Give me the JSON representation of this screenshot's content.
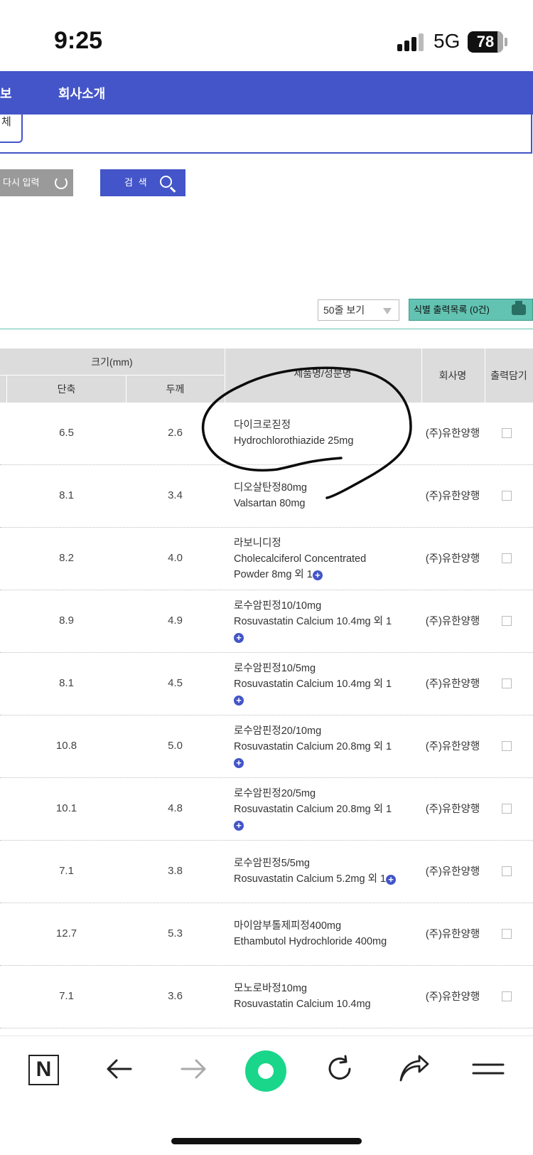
{
  "status": {
    "time": "9:25",
    "network": "5G",
    "battery": "78"
  },
  "nav": {
    "item_partial": "보",
    "company_intro": "회사소개"
  },
  "search": {
    "partial_field_text": "체",
    "reset_label": "다시 입력",
    "search_label": "검 색"
  },
  "list_controls": {
    "per_page": "50줄 보기",
    "print_list": "식별 출력목록 (0건)"
  },
  "table": {
    "headers": {
      "size_group": "크기(mm)",
      "short_axis": "단축",
      "thickness": "두께",
      "product": "제품명/성분명",
      "company": "회사명",
      "add_print": "출력담기"
    },
    "rows": [
      {
        "short": "6.5",
        "thick": "2.6",
        "name": "다이크로짇정",
        "ingredient": "Hydrochlorothiazide   25mg",
        "company": "(주)유한양행"
      },
      {
        "short": "8.1",
        "thick": "3.4",
        "name": "디오살탄정80mg",
        "ingredient": "Valsartan   80mg",
        "company": "(주)유한양행"
      },
      {
        "short": "8.2",
        "thick": "4.0",
        "name": "라보니디정",
        "ingredient": "Cholecalciferol Concentrated",
        "ingredient2": "Powder   8mg 외 1",
        "company": "(주)유한양행",
        "plus": true
      },
      {
        "short": "8.9",
        "thick": "4.9",
        "name": "로수암핀정10/10mg",
        "ingredient": "Rosuvastatin Calcium   10.4mg 외 1",
        "company": "(주)유한양행",
        "plus_line": true
      },
      {
        "short": "8.1",
        "thick": "4.5",
        "name": "로수암핀정10/5mg",
        "ingredient": "Rosuvastatin Calcium   10.4mg 외 1",
        "company": "(주)유한양행",
        "plus_line": true
      },
      {
        "short": "10.8",
        "thick": "5.0",
        "name": "로수암핀정20/10mg",
        "ingredient": "Rosuvastatin Calcium   20.8mg 외 1",
        "company": "(주)유한양행",
        "plus_line": true
      },
      {
        "short": "10.1",
        "thick": "4.8",
        "name": "로수암핀정20/5mg",
        "ingredient": "Rosuvastatin Calcium   20.8mg 외 1",
        "company": "(주)유한양행",
        "plus_line": true
      },
      {
        "short": "7.1",
        "thick": "3.8",
        "name": "로수암핀정5/5mg",
        "ingredient": "Rosuvastatin Calcium   5.2mg 외 1",
        "company": "(주)유한양행",
        "plus": true
      },
      {
        "short": "12.7",
        "thick": "5.3",
        "name": "마이암부톨제피정400mg",
        "ingredient": "Ethambutol Hydrochloride   400mg",
        "company": "(주)유한양행"
      },
      {
        "short": "7.1",
        "thick": "3.6",
        "name": "모노로바정10mg",
        "ingredient": "Rosuvastatin Calcium   10.4mg",
        "company": "(주)유한양행"
      }
    ]
  },
  "browser": {
    "n_button": "N"
  },
  "colors": {
    "primary": "#4355c8",
    "teal": "#62c3b2",
    "green": "#19d68a"
  }
}
